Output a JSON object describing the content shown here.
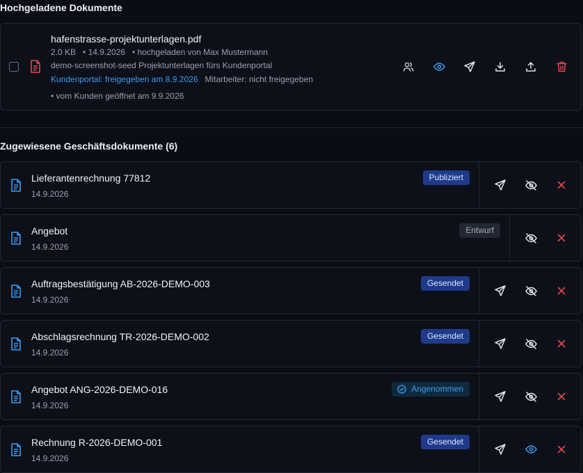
{
  "uploaded": {
    "title": "Hochgeladene Dokumente",
    "file": {
      "name": "hafenstrasse-projektunterlagen.pdf",
      "size": "2.0 KB",
      "date": "• 14.9.2026",
      "uploader": "• hochgeladen von Max Mustermann",
      "description": "demo-screenshot-seed Projektunterlagen fürs Kundenportal",
      "portal_status": "Kundenportal: freigegeben am 8.9.2026",
      "employee_status": "Mitarbeiter: nicht freigegeben",
      "opened": "• vom Kunden geöffnet am 9.9.2026"
    }
  },
  "assigned": {
    "title": "Zugewiesene Geschäftsdokumente (6)",
    "docs": [
      {
        "title": "Lieferantenrechnung 77812",
        "date": "14.9.2026",
        "badge": "Publiziert"
      },
      {
        "title": "Angebot",
        "date": "14.9.2026",
        "badge": "Entwurf"
      },
      {
        "title": "Auftragsbestätigung AB-2026-DEMO-003",
        "date": "14.9.2026",
        "badge": "Gesendet"
      },
      {
        "title": "Abschlagsrechnung TR-2026-DEMO-002",
        "date": "14.9.2026",
        "badge": "Gesendet"
      },
      {
        "title": "Angebot ANG-2026-DEMO-016",
        "date": "14.9.2026",
        "badge": "Angenommen"
      },
      {
        "title": "Rechnung R-2026-DEMO-001",
        "date": "14.9.2026",
        "badge": "Gesendet"
      }
    ]
  },
  "icons": {
    "file": "pdf-file-icon",
    "doc": "document-icon",
    "actions": [
      "users-icon",
      "eye-icon",
      "send-icon",
      "download-icon",
      "upload-icon",
      "trash-icon"
    ],
    "row_actions": [
      "send-icon",
      "eye-off-icon",
      "close-icon"
    ]
  },
  "colors": {
    "accent": "#3b9cf0",
    "danger": "#e5484d",
    "badge_blue": "#1e3a8a",
    "badge_gray": "#222733",
    "background": "#0a0d14"
  }
}
